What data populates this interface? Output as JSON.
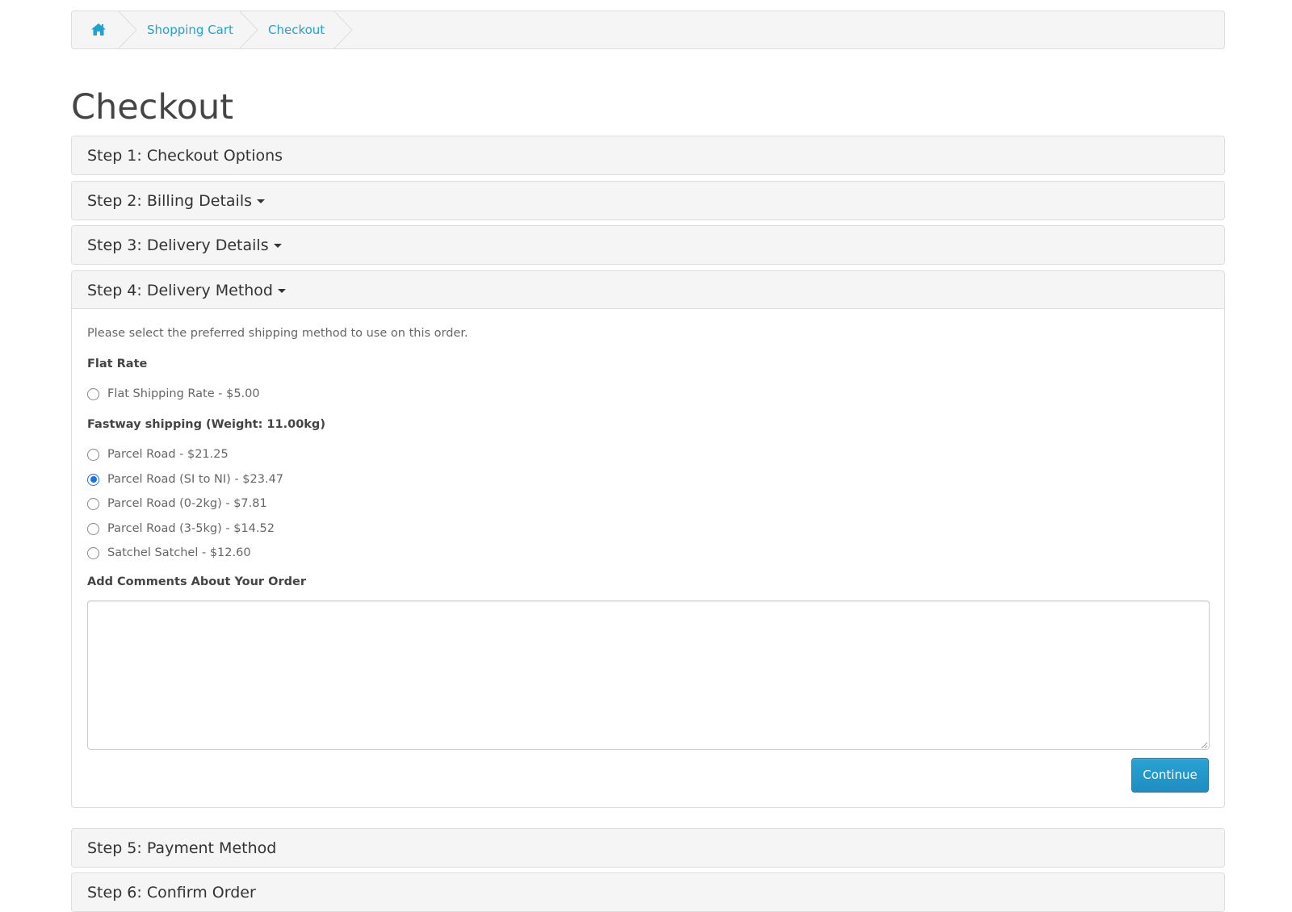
{
  "breadcrumb": {
    "home_icon": "home-icon",
    "items": [
      "Shopping Cart",
      "Checkout"
    ]
  },
  "page": {
    "title": "Checkout"
  },
  "steps": [
    {
      "label": "Step 1: Checkout Options",
      "has_caret": false
    },
    {
      "label": "Step 2: Billing Details",
      "has_caret": true
    },
    {
      "label": "Step 3: Delivery Details",
      "has_caret": true
    },
    {
      "label": "Step 4: Delivery Method",
      "has_caret": true,
      "expanded": true
    },
    {
      "label": "Step 5: Payment Method",
      "has_caret": false
    },
    {
      "label": "Step 6: Confirm Order",
      "has_caret": false
    }
  ],
  "delivery": {
    "intro": "Please select the preferred shipping method to use on this order.",
    "flat_rate_label": "Flat Rate",
    "flat_options": [
      {
        "label": "Flat Shipping Rate - $5.00",
        "selected": false
      }
    ],
    "fastway_label": "Fastway shipping (Weight: 11.00kg)",
    "fastway_options": [
      {
        "label": "Parcel Road - $21.25",
        "selected": false
      },
      {
        "label": "Parcel Road (SI to NI) - $23.47",
        "selected": true
      },
      {
        "label": "Parcel Road (0-2kg) - $7.81",
        "selected": false
      },
      {
        "label": "Parcel Road (3-5kg) - $14.52",
        "selected": false
      },
      {
        "label": "Satchel Satchel - $12.60",
        "selected": false
      }
    ],
    "comments_label": "Add Comments About Your Order",
    "comments_value": "",
    "continue_label": "Continue"
  },
  "colors": {
    "link": "#23a1d1",
    "button": "#229ac8",
    "radio_selected": "#1a73e8",
    "panel_bg": "#f5f5f5"
  }
}
